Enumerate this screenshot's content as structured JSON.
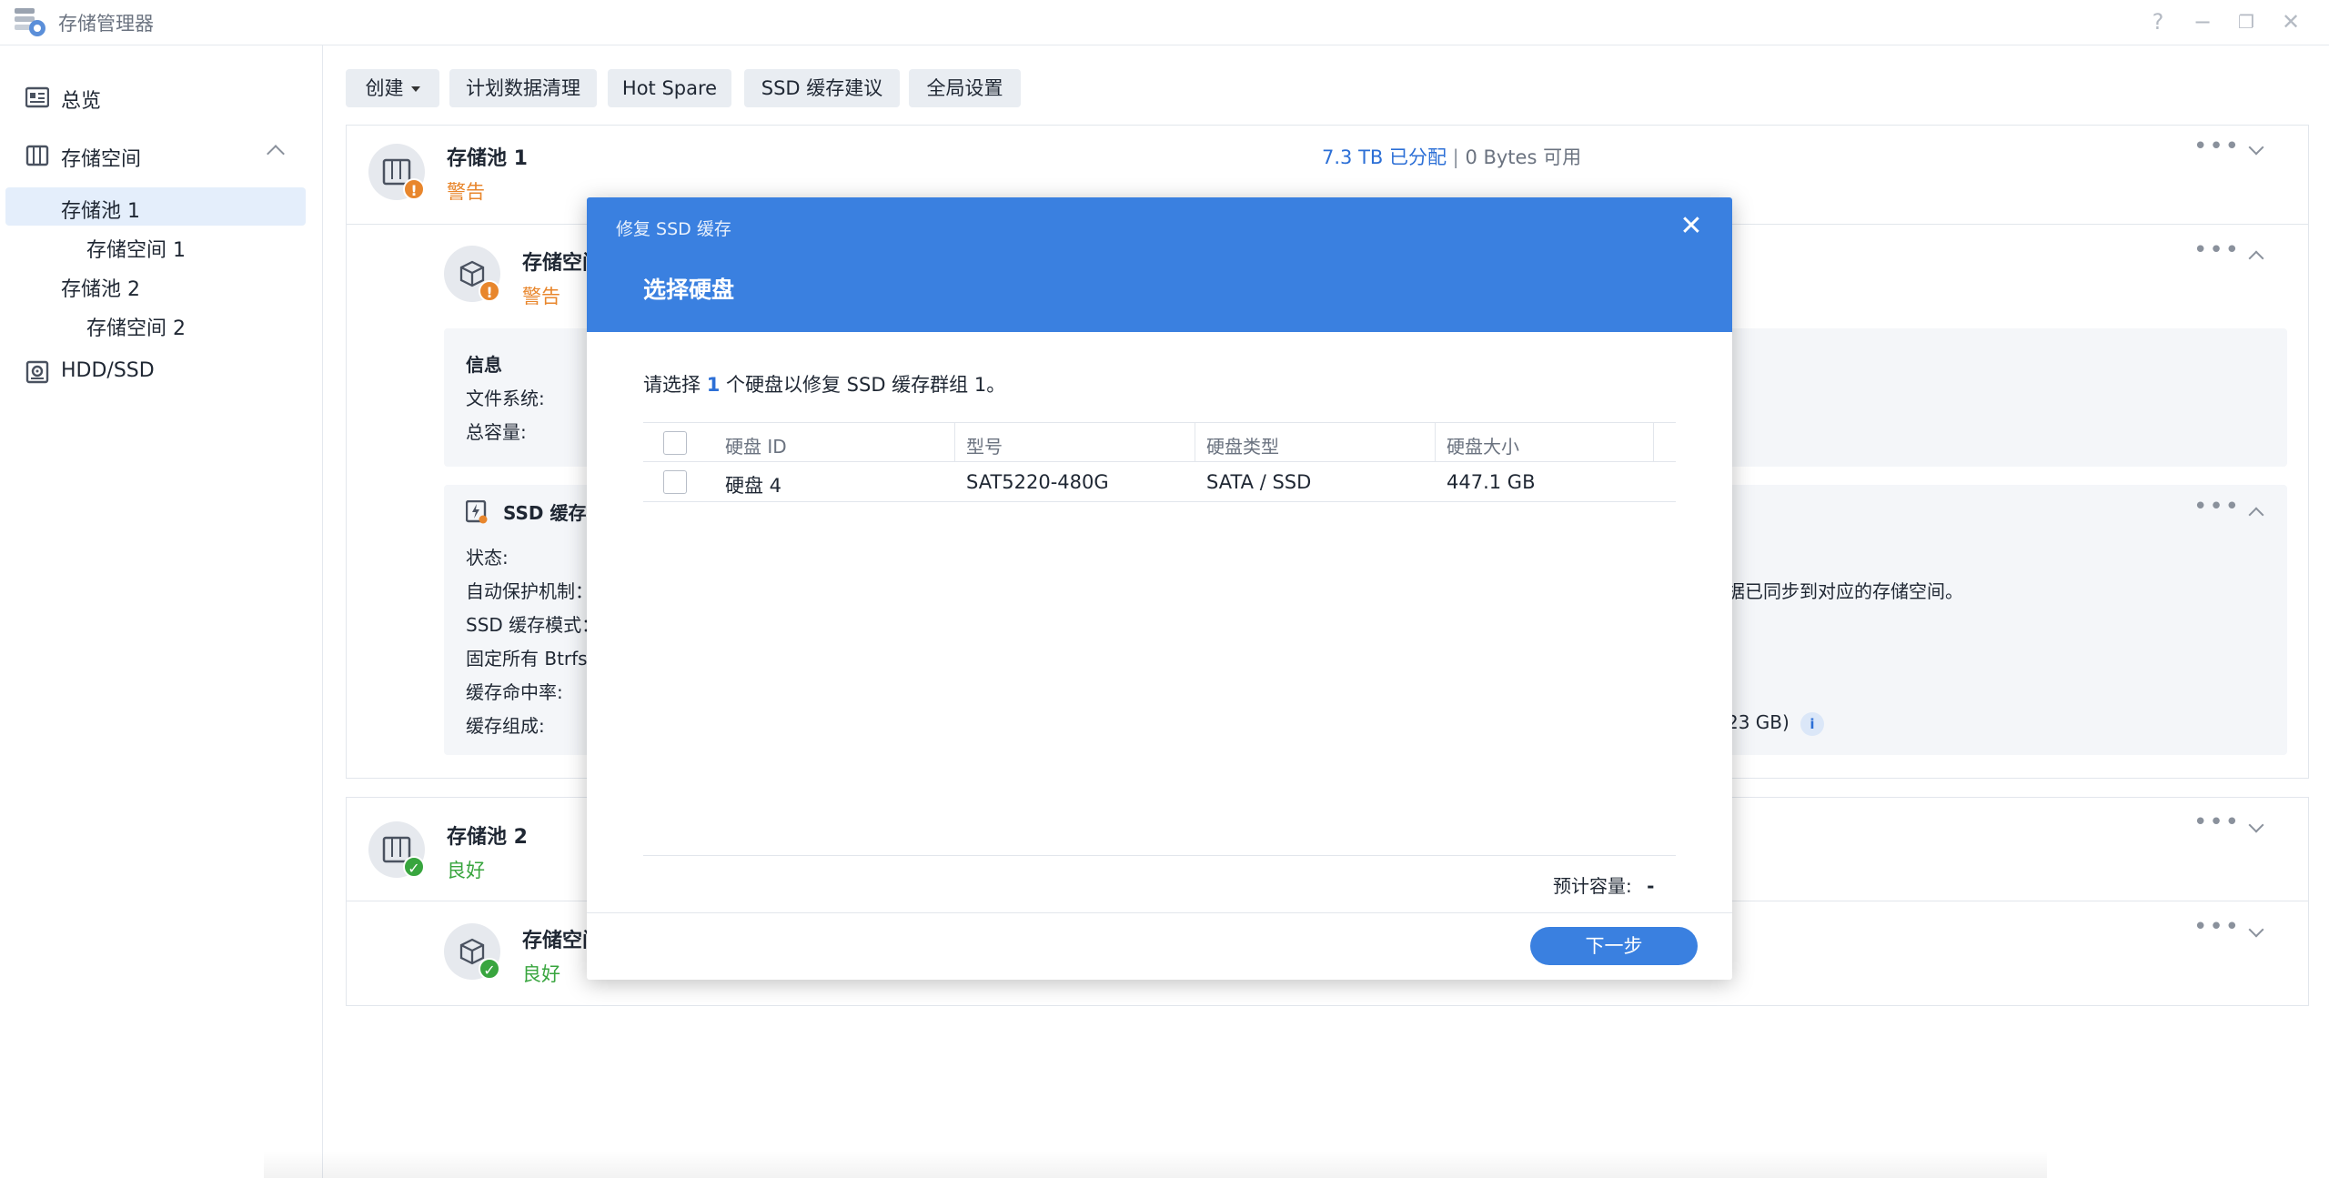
{
  "window": {
    "title": "存储管理器",
    "controls": [
      "?",
      "−",
      "❐",
      "✕"
    ]
  },
  "sidebar": {
    "items": [
      {
        "label": "总览",
        "icon": "overview-icon"
      },
      {
        "label": "存储空间",
        "icon": "storage-icon"
      },
      {
        "label": "存储池 1"
      },
      {
        "label": "存储空间 1"
      },
      {
        "label": "存储池 2"
      },
      {
        "label": "存储空间 2"
      },
      {
        "label": "HDD/SSD",
        "icon": "disk-icon"
      }
    ]
  },
  "toolbar": {
    "create": "创建",
    "scrub": "计划数据清理",
    "hot_spare": "Hot Spare",
    "ssd_advisor": "SSD 缓存建议",
    "global_settings": "全局设置"
  },
  "pool1": {
    "name": "存储池 1",
    "status": "警告",
    "allocated": "7.3 TB 已分配",
    "separator": "|",
    "available": "0 Bytes 可用",
    "volume": {
      "name": "存储空间",
      "status": "警告"
    },
    "info": {
      "heading": "信息",
      "filesystem": "文件系统:",
      "capacity": "总容量:"
    },
    "ssd": {
      "heading": "SSD 缓存",
      "state": "状态:",
      "auto_protect": "自动保护机制：",
      "auto_protect_tail": "据已同步到对应的存储空间。",
      "mode": "SSD 缓存模式：",
      "pin": "固定所有 Btrfs",
      "hit_rate": "缓存命中率:",
      "composition": "缓存组成:",
      "composition_tail": "23 GB)",
      "info_icon": "i"
    }
  },
  "pool2": {
    "name": "存储池 2",
    "status": "良好",
    "volume": {
      "name": "存储空间",
      "status": "良好"
    }
  },
  "dialog": {
    "title": "修复 SSD 缓存",
    "subtitle": "选择硬盘",
    "prompt_pre": "请选择",
    "prompt_count": "1",
    "prompt_post": "个硬盘以修复 SSD 缓存群组 1。",
    "columns": [
      "硬盘 ID",
      "型号",
      "硬盘类型",
      "硬盘大小"
    ],
    "rows": [
      {
        "id": "硬盘 4",
        "model": "SAT5220-480G",
        "type": "SATA / SSD",
        "size": "447.1 GB"
      }
    ],
    "capacity_label": "预计容量:",
    "capacity_value": "-",
    "next": "下一步",
    "close": "✕"
  }
}
